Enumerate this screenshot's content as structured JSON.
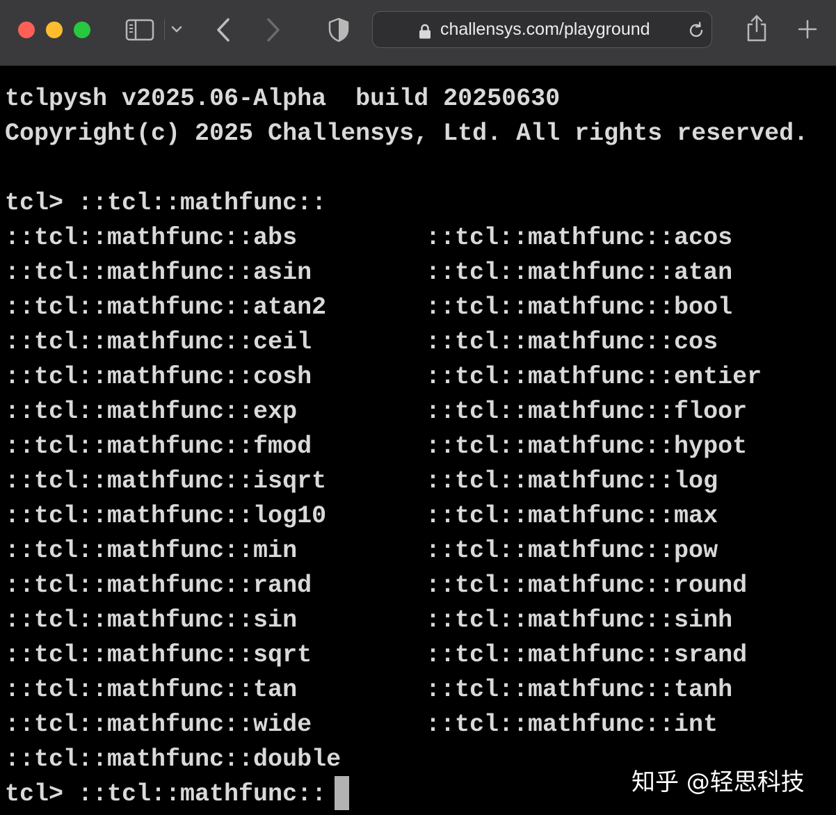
{
  "browser": {
    "url": "challensys.com/playground",
    "icons": {
      "close": "close-window-dot",
      "minimize": "minimize-window-dot",
      "zoom": "zoom-window-dot",
      "sidebar": "sidebar-icon",
      "tab_group_menu": "chevron-down-icon",
      "back": "back-arrow-icon",
      "forward": "forward-arrow-icon",
      "privacy": "shield-icon",
      "secure": "lock-icon",
      "reload": "reload-icon",
      "share": "share-icon",
      "new_tab": "plus-icon"
    },
    "colors": {
      "close": "#ff5f57",
      "minimize": "#febc2e",
      "zoom": "#28c840"
    }
  },
  "terminal": {
    "banner": [
      "tclpysh v2025.06-Alpha  build 20250630",
      "Copyright(c) 2025 Challensys, Ltd. All rights reserved."
    ],
    "prompt": "tcl> ",
    "command": "::tcl::mathfunc::",
    "completions": [
      [
        "::tcl::mathfunc::abs",
        "::tcl::mathfunc::acos"
      ],
      [
        "::tcl::mathfunc::asin",
        "::tcl::mathfunc::atan"
      ],
      [
        "::tcl::mathfunc::atan2",
        "::tcl::mathfunc::bool"
      ],
      [
        "::tcl::mathfunc::ceil",
        "::tcl::mathfunc::cos"
      ],
      [
        "::tcl::mathfunc::cosh",
        "::tcl::mathfunc::entier"
      ],
      [
        "::tcl::mathfunc::exp",
        "::tcl::mathfunc::floor"
      ],
      [
        "::tcl::mathfunc::fmod",
        "::tcl::mathfunc::hypot"
      ],
      [
        "::tcl::mathfunc::isqrt",
        "::tcl::mathfunc::log"
      ],
      [
        "::tcl::mathfunc::log10",
        "::tcl::mathfunc::max"
      ],
      [
        "::tcl::mathfunc::min",
        "::tcl::mathfunc::pow"
      ],
      [
        "::tcl::mathfunc::rand",
        "::tcl::mathfunc::round"
      ],
      [
        "::tcl::mathfunc::sin",
        "::tcl::mathfunc::sinh"
      ],
      [
        "::tcl::mathfunc::sqrt",
        "::tcl::mathfunc::srand"
      ],
      [
        "::tcl::mathfunc::tan",
        "::tcl::mathfunc::tanh"
      ],
      [
        "::tcl::mathfunc::wide",
        "::tcl::mathfunc::int"
      ],
      [
        "::tcl::mathfunc::double",
        ""
      ]
    ],
    "input": "::tcl::mathfunc::"
  },
  "watermark": "知乎 @轻思科技"
}
